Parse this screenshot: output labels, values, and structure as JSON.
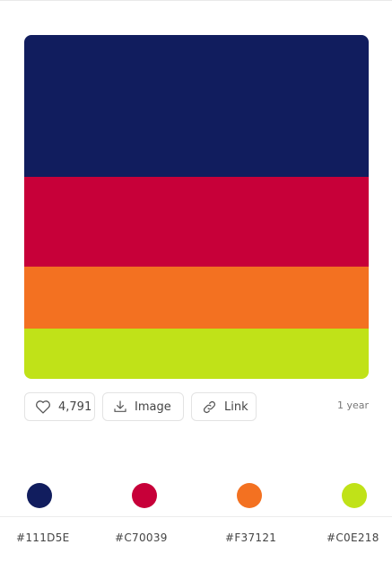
{
  "palette": {
    "colors": [
      {
        "hex": "#111D5E",
        "label": "#111D5E"
      },
      {
        "hex": "#C70039",
        "label": "#C70039"
      },
      {
        "hex": "#F37121",
        "label": "#F37121"
      },
      {
        "hex": "#C0E218",
        "label": "#C0E218"
      }
    ]
  },
  "actions": {
    "likes": "4,791",
    "image_label": "Image",
    "link_label": "Link"
  },
  "meta": {
    "age": "1 year"
  }
}
